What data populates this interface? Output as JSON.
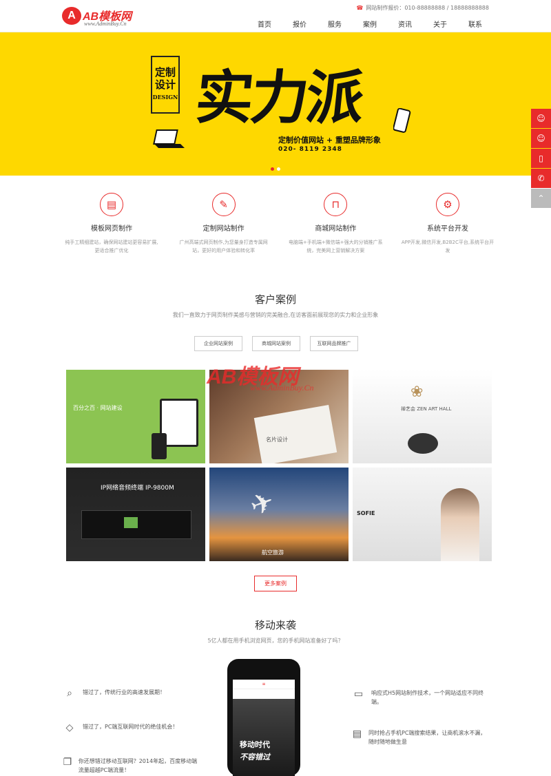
{
  "header": {
    "logo_badge": "A",
    "logo_name": "AB模板网",
    "logo_url": "www.AdminBuy.Cn",
    "hotline": "网站制作报价：010-88888888 / 18888888888",
    "nav": [
      "首页",
      "报价",
      "服务",
      "案例",
      "资讯",
      "关于",
      "联系"
    ]
  },
  "banner": {
    "stamp": [
      "定制",
      "设计"
    ],
    "stamp_en": "DESIGN",
    "headline": "实力派",
    "slogan": "定制价值网站 + 重塑品牌形象",
    "phone": "020- 8119 2348"
  },
  "services": [
    {
      "icon": "template-icon",
      "title": "模板网页制作",
      "desc": "纯手工精细建站，确保网站建站更容易扩展,更适合推广优化"
    },
    {
      "icon": "pencil-icon",
      "title": "定制网站制作",
      "desc": "广州高端式网页制作,为您量身打造专属网站，更好的用户体验和转化率"
    },
    {
      "icon": "bag-icon",
      "title": "商城网站制作",
      "desc": "电脑端+手机端+微信端+强大的分销推广系统，完美网上营销解决方案"
    },
    {
      "icon": "gear-icon",
      "title": "系统平台开发",
      "desc": "APP开发,微信开发,B2B2C平台,系统平台开发"
    }
  ],
  "cases": {
    "title": "客户案例",
    "subtitle": "我们一直致力于网页制作美感与营销的完美融合,在访客面前展现您的实力和企业形象",
    "tabs": [
      "企业网站案例",
      "商城网站案例",
      "互联网品牌推广"
    ],
    "watermark": "AB模板网",
    "watermark_url": "www.AdminBuy.Cn",
    "items": [
      {
        "caption": "百分之百 · 网站建设"
      },
      {
        "caption": "名片设计"
      },
      {
        "caption": "禅艺会 ZEN ART HALL"
      },
      {
        "caption": "IP网络音频终端 IP-9800M"
      },
      {
        "caption": "航空旅游"
      },
      {
        "caption": "SOFIE"
      }
    ],
    "more": "更多案例"
  },
  "mobile": {
    "title": "移动来袭",
    "subtitle": "5亿人都在用手机浏览网页，您的手机网站准备好了吗？",
    "screen_text_1": "移动时代",
    "screen_text_2": "不容错过",
    "left": [
      {
        "icon": "search-icon",
        "text": "错过了，传统行业的高速发展期！"
      },
      {
        "icon": "diamond-icon",
        "text": "错过了，PC端互联网时代的绝佳机会！"
      },
      {
        "icon": "pages-icon",
        "text": "你还想错过移动互联网？2014年起，百度移动端流量超越PC端流量！"
      }
    ],
    "right": [
      {
        "icon": "responsive-icon",
        "text": "响应式H5网站制作技术，一个网站适应不同终端。"
      },
      {
        "icon": "screen-icon",
        "text": "同时抢占手机PC端搜索结果，让商机滚水不漏，随时随地做生意"
      }
    ]
  },
  "sidebar": [
    "qq-icon",
    "qq-icon",
    "mobile-icon",
    "phone-icon",
    "top-icon"
  ]
}
